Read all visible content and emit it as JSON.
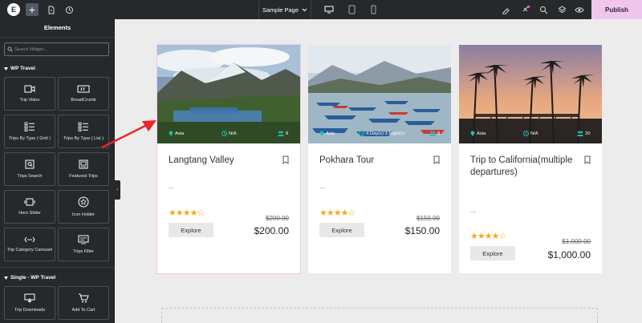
{
  "topbar": {
    "logo": "E",
    "page_name": "Sample Page",
    "publish_label": "Publish"
  },
  "sidebar": {
    "title": "Elements",
    "search_placeholder": "Search Widget...",
    "section1": "WP Travel",
    "section2": "Single - WP Travel",
    "widgets": [
      {
        "label": "Trip Video",
        "icon": "video-icon"
      },
      {
        "label": "BreadCrumb",
        "icon": "breadcrumb-icon"
      },
      {
        "label": "Trips By Type ( Grid )",
        "icon": "grid-list-icon"
      },
      {
        "label": "Trips By Type ( List )",
        "icon": "list-icon"
      },
      {
        "label": "Trips Search",
        "icon": "search-box-icon"
      },
      {
        "label": "Featured Trips",
        "icon": "featured-icon"
      },
      {
        "label": "Hero Slider",
        "icon": "slider-icon"
      },
      {
        "label": "Icon Holder",
        "icon": "star-icon"
      },
      {
        "label": "Trip Category Carousel",
        "icon": "carousel-icon"
      },
      {
        "label": "Trips Filter",
        "icon": "filter-icon"
      },
      {
        "label": "Trip Downloads",
        "icon": "download-icon"
      },
      {
        "label": "Add To Cart",
        "icon": "cart-icon"
      }
    ]
  },
  "cards": [
    {
      "title": "Langtang Valley",
      "location": "Asia",
      "duration": "N/A",
      "group": "8",
      "excerpt": "...",
      "rating": 4,
      "old_price": "$200.00",
      "price": "$200.00",
      "button": "Explore"
    },
    {
      "title": "Pokhara Tour",
      "location": "Asia",
      "duration": "4 Day(s) 3 Night(s)",
      "group": "8",
      "excerpt": "...",
      "rating": 4,
      "old_price": "$150.00",
      "price": "$150.00",
      "button": "Explore"
    },
    {
      "title": "Trip to California(multiple departures)",
      "location": "Asia",
      "duration": "N/A",
      "group": "20",
      "excerpt": "...",
      "rating": 4,
      "old_price": "$1,000.00",
      "price": "$1,000.00",
      "button": "Explore"
    }
  ],
  "colors": {
    "topbar": "#26292c",
    "publish": "#f0c5ee",
    "star": "#f5a623",
    "meta_icon": "#1fc0b5",
    "arrow": "#e8262a"
  }
}
